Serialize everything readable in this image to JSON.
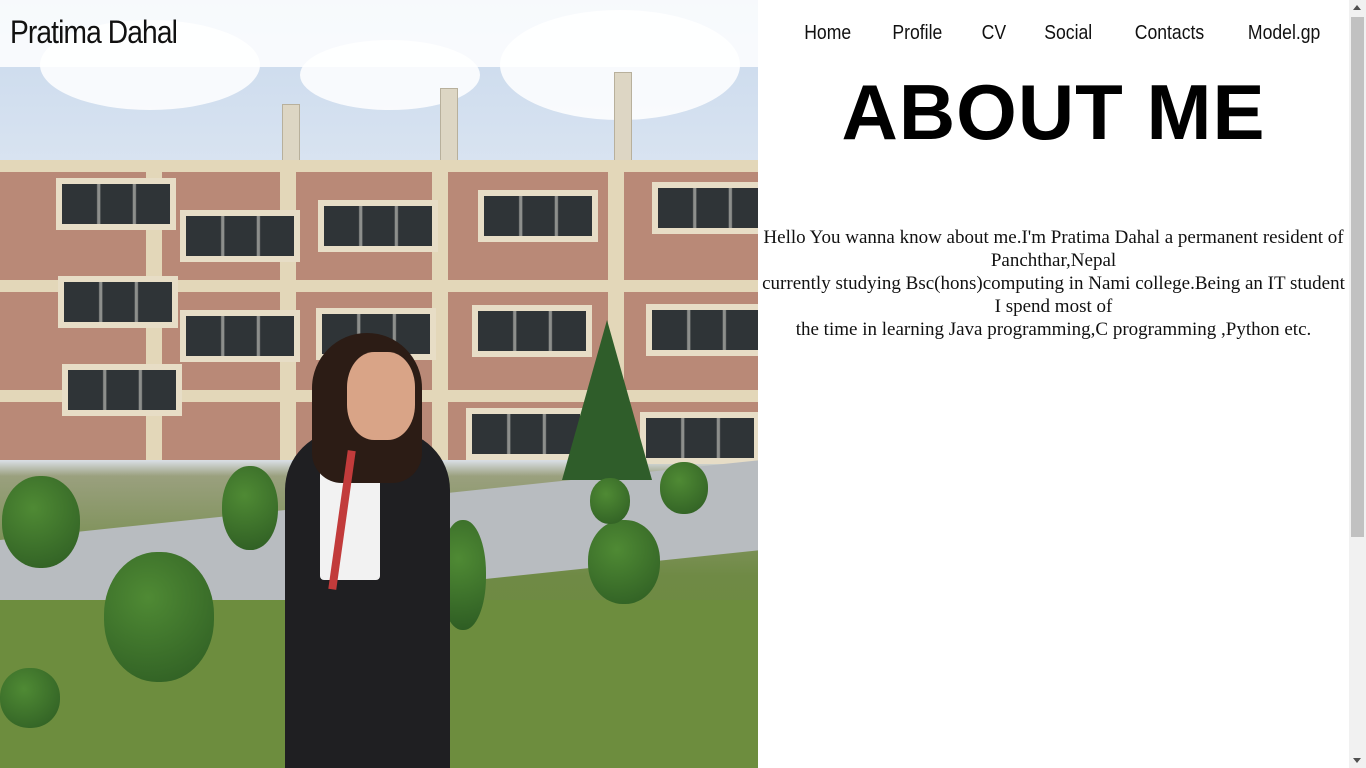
{
  "header": {
    "brand": "Pratima Dahal",
    "nav": [
      {
        "label": "Home"
      },
      {
        "label": "Profile"
      },
      {
        "label": "CV"
      },
      {
        "label": "Social"
      },
      {
        "label": "Contacts"
      },
      {
        "label": "Model.gp"
      }
    ]
  },
  "about": {
    "heading": "ABOUT ME",
    "lines": [
      "Hello You wanna know about me.I'm Pratima Dahal a permanent resident of Panchthar,Nepal",
      "currently studying Bsc(hons)computing in Nami college.Being an IT student I spend most of",
      "the time in learning Java programming,C programming ,Python etc."
    ]
  },
  "colors": {
    "header_bg": "#ffffff",
    "text": "#111111",
    "heading": "#000000"
  },
  "icons": {
    "scroll_up": "chevron-up-icon",
    "scroll_down": "chevron-down-icon"
  }
}
